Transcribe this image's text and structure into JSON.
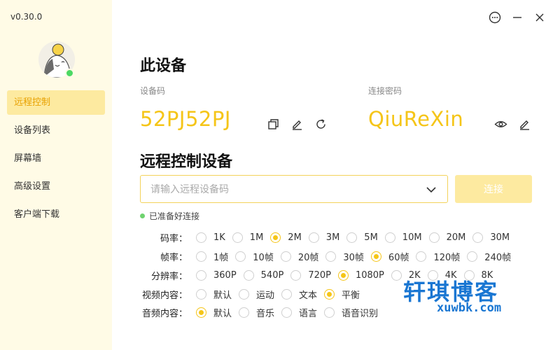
{
  "app": {
    "version": "v0.30.0"
  },
  "colors": {
    "accent": "#f5c518",
    "sidebar_bg": "#fffbe6",
    "active_bg": "#fdeaa0",
    "online": "#4cd964"
  },
  "sidebar": {
    "items": [
      {
        "label": "远程控制",
        "active": true
      },
      {
        "label": "设备列表",
        "active": false
      },
      {
        "label": "屏幕墙",
        "active": false
      },
      {
        "label": "高级设置",
        "active": false
      },
      {
        "label": "客户端下载",
        "active": false
      }
    ]
  },
  "window": {
    "icons": [
      "chat-icon",
      "minimize-icon",
      "close-icon"
    ]
  },
  "device": {
    "title": "此设备",
    "code_label": "设备码",
    "code": "52PJ52PJ",
    "password_label": "连接密码",
    "password": "QiuReXin"
  },
  "remote": {
    "title": "远程控制设备",
    "input_placeholder": "请输入远程设备码",
    "input_value": "",
    "connect_label": "连接",
    "status": "已准备好连接"
  },
  "options": {
    "bitrate": {
      "label": "码率：",
      "choices": [
        "1K",
        "1M",
        "2M",
        "3M",
        "5M",
        "10M",
        "20M",
        "30M"
      ],
      "selected": "2M"
    },
    "framerate": {
      "label": "帧率：",
      "choices": [
        "1帧",
        "10帧",
        "20帧",
        "30帧",
        "60帧",
        "120帧",
        "240帧"
      ],
      "selected": "60帧"
    },
    "resolution": {
      "label": "分辨率：",
      "choices": [
        "360P",
        "540P",
        "720P",
        "1080P",
        "2K",
        "4K",
        "8K"
      ],
      "selected": "1080P"
    },
    "video_content": {
      "label": "视频内容：",
      "choices": [
        "默认",
        "运动",
        "文本",
        "平衡"
      ],
      "selected": "平衡"
    },
    "audio_content": {
      "label": "音频内容：",
      "choices": [
        "默认",
        "音乐",
        "语言",
        "语音识别"
      ],
      "selected": "默认"
    }
  },
  "watermark": {
    "title": "轩琪博客",
    "url": "xuwbk.com"
  }
}
